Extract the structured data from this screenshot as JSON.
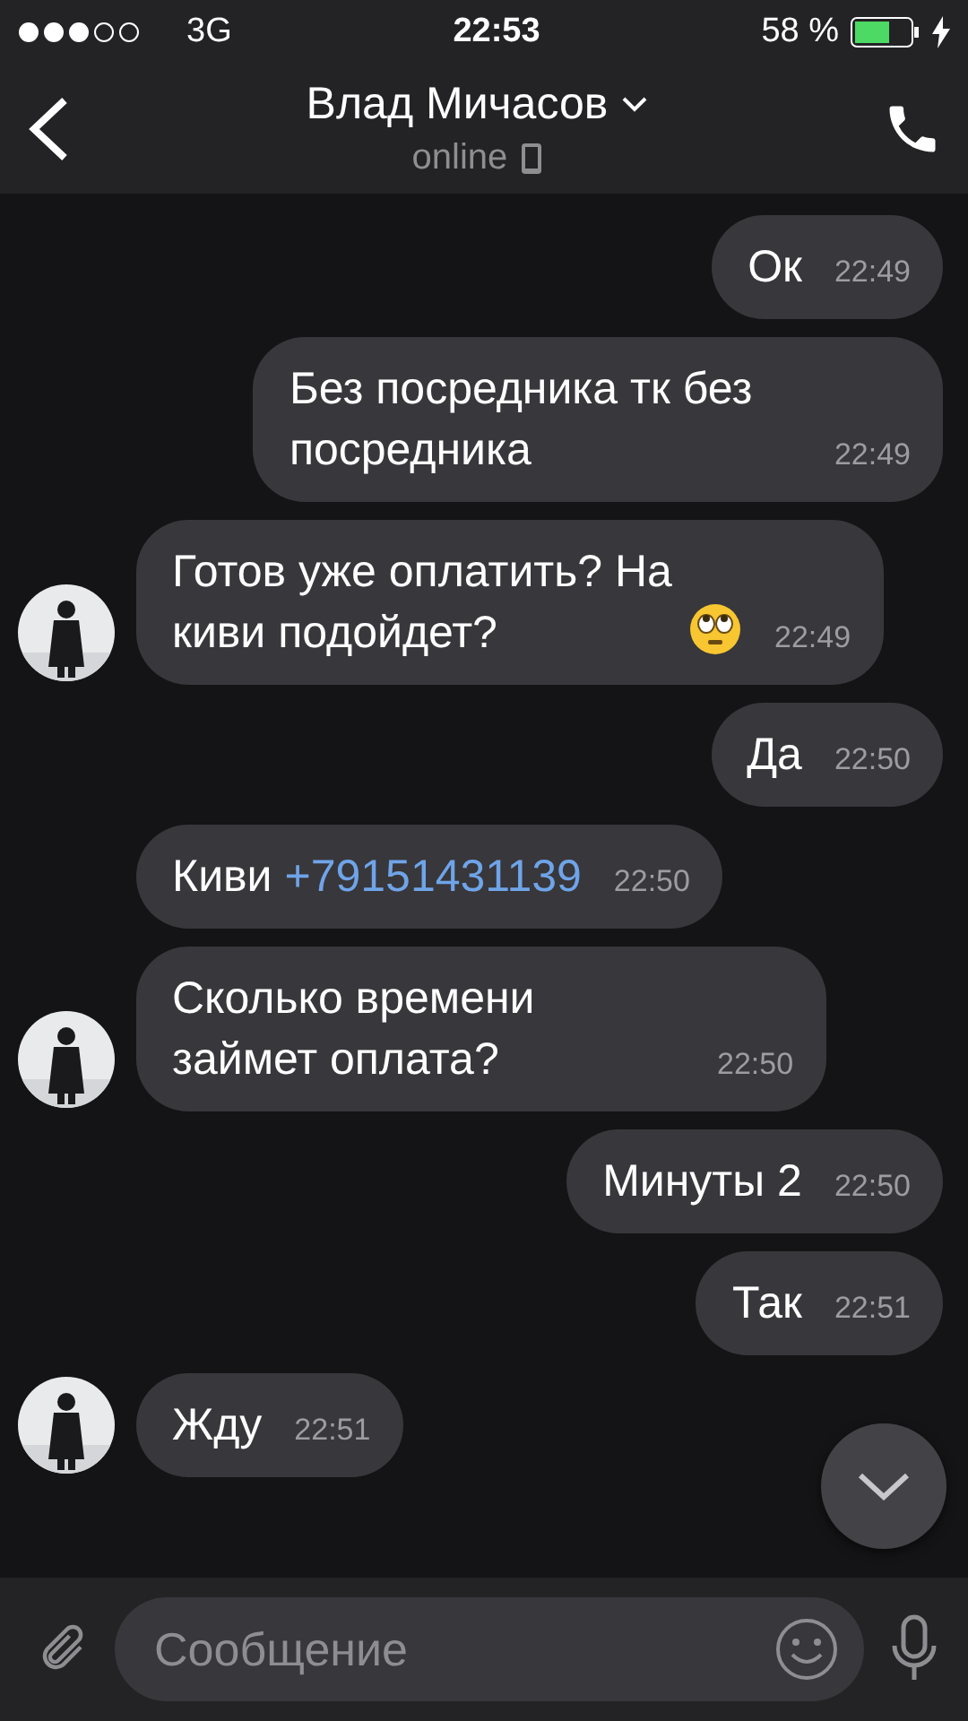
{
  "status_bar": {
    "carrier": "3G",
    "time": "22:53",
    "battery": "58 %"
  },
  "header": {
    "title": "Влад Мичасов",
    "subtitle": "online"
  },
  "messages": [
    {
      "kind": "outgoing",
      "text": "Ок",
      "time": "22:49"
    },
    {
      "kind": "outgoing",
      "text": "Без посредника тк без посредника",
      "time": "22:49"
    },
    {
      "kind": "incoming",
      "text": "Готов уже оплатить? На киви подойдет?",
      "emoji": true,
      "time": "22:49",
      "avatar": true
    },
    {
      "kind": "outgoing",
      "text": "Да",
      "time": "22:50"
    },
    {
      "kind": "incoming",
      "text": "Киви",
      "link": "+79151431139",
      "time": "22:50",
      "avatar": false
    },
    {
      "kind": "incoming",
      "text": "Сколько времени займет оплата?",
      "time": "22:50",
      "avatar": true
    },
    {
      "kind": "outgoing",
      "text": "Минуты 2",
      "time": "22:50"
    },
    {
      "kind": "outgoing",
      "text": "Так",
      "time": "22:51"
    },
    {
      "kind": "incoming",
      "text": "Жду",
      "time": "22:51",
      "avatar": true
    }
  ],
  "composer": {
    "placeholder": "Сообщение"
  }
}
